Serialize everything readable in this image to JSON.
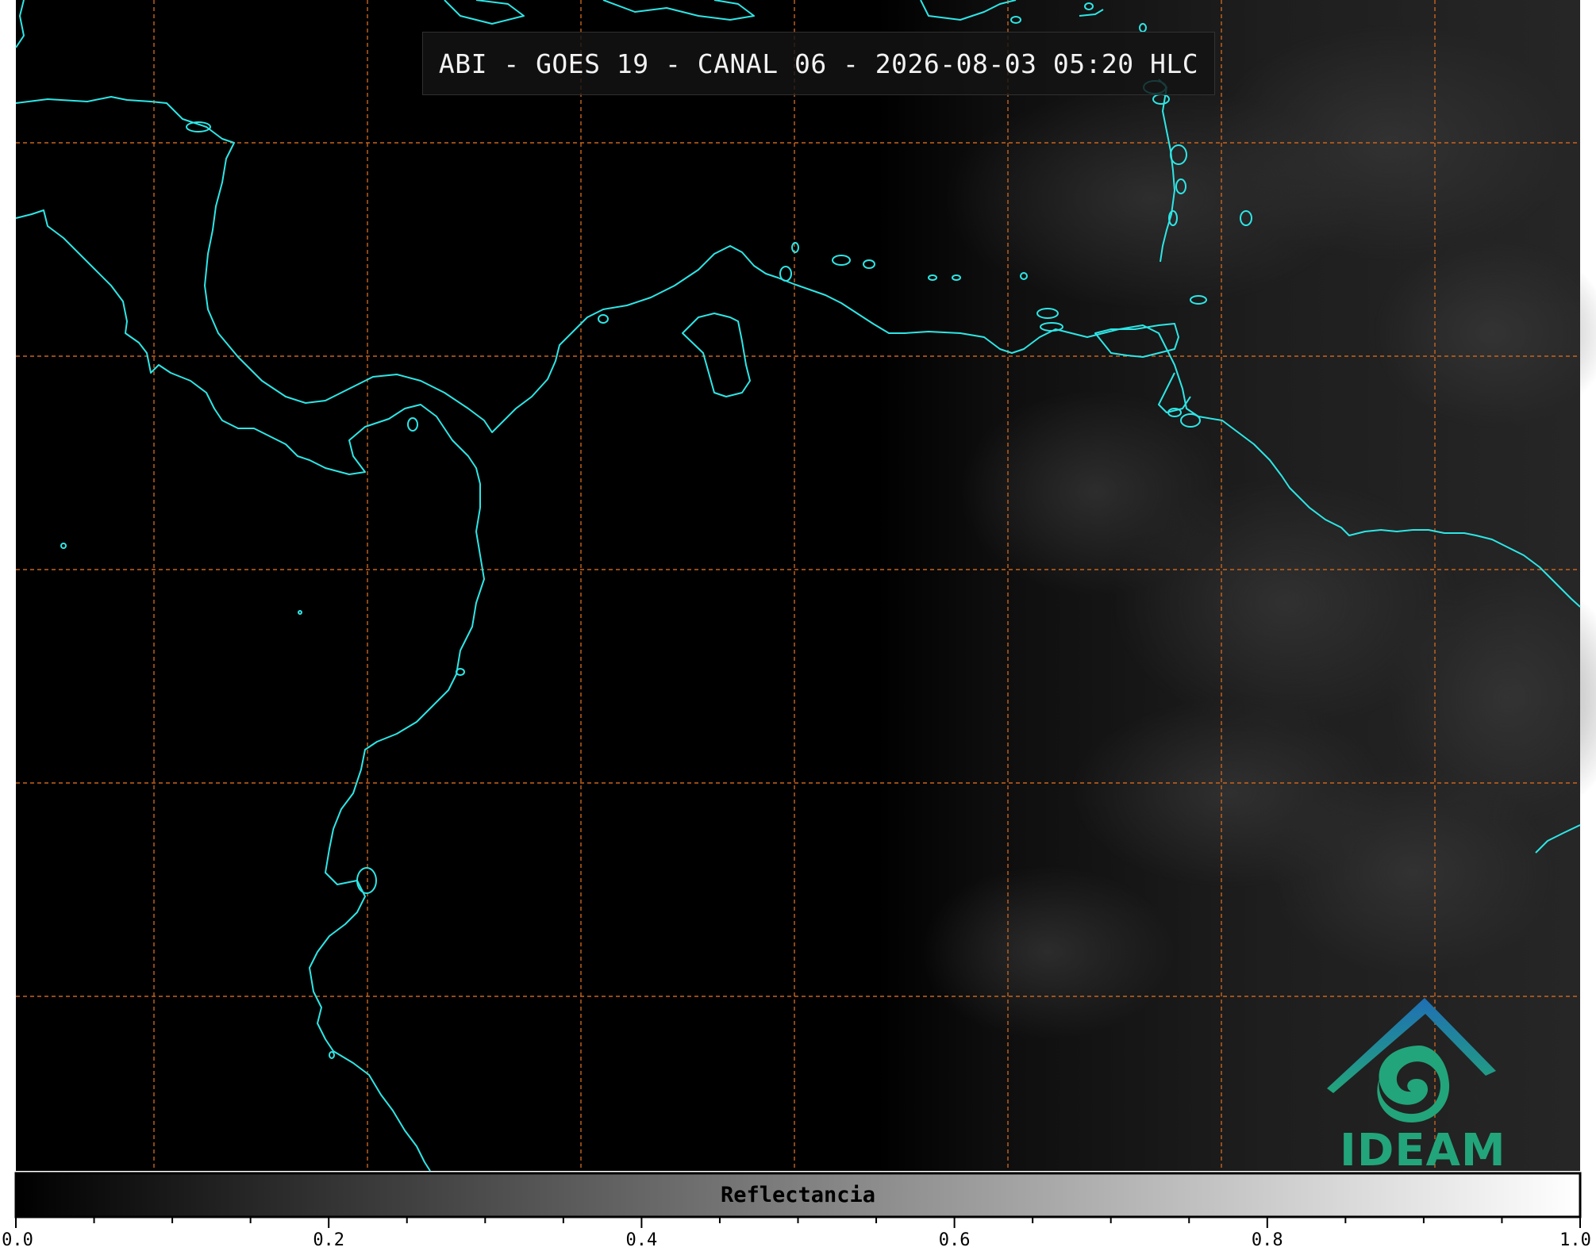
{
  "title": "ABI - GOES 19 - CANAL 06 - 2026-08-03 05:20 HLC",
  "colorbar": {
    "label": "Reflectancia",
    "min": 0.0,
    "max": 1.0,
    "tick_labels": [
      "0.0",
      "0.2",
      "0.4",
      "0.6",
      "0.8",
      "1.0"
    ],
    "tick_values": [
      0.0,
      0.2,
      0.4,
      0.6,
      0.8,
      1.0
    ],
    "minor_tick_step": 0.05,
    "colormap": "gray (black to white)"
  },
  "logo": {
    "text": "IDEAM"
  },
  "colors": {
    "coastline": "#2ee6e6",
    "gridlines": "#c8641e",
    "background": "#000000",
    "logo_top": "#1f6fb5",
    "logo_bottom": "#22a57a"
  }
}
